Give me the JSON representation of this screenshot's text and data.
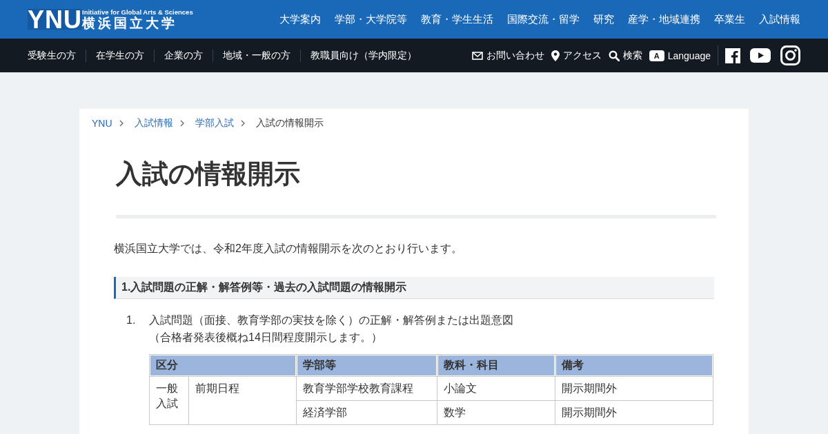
{
  "header": {
    "logo": {
      "mark": "YNU",
      "tagline": "Initiative for Global Arts & Sciences",
      "name": "横浜国立大学"
    },
    "nav": [
      "大学案内",
      "学部・大学院等",
      "教育・学生生活",
      "国際交流・留学",
      "研究",
      "産学・地域連携",
      "卒業生",
      "入試情報"
    ]
  },
  "subnav": {
    "audiences": [
      "受験生の方",
      "在学生の方",
      "企業の方",
      "地域・一般の方",
      "教職員向け（学内限定）"
    ],
    "tools": [
      {
        "kind": "mail",
        "label": "お問い合わせ"
      },
      {
        "kind": "pin",
        "label": "アクセス"
      },
      {
        "kind": "search",
        "label": "検索"
      },
      {
        "kind": "language",
        "label": "Language",
        "badge": "A"
      }
    ],
    "social": [
      {
        "kind": "facebook"
      },
      {
        "kind": "youtube"
      },
      {
        "kind": "instagram"
      }
    ]
  },
  "breadcrumb": [
    {
      "label": "YNU",
      "link": true
    },
    {
      "label": "入試情報",
      "link": true
    },
    {
      "label": "学部入試",
      "link": true
    },
    {
      "label": "入試の情報開示",
      "link": false
    }
  ],
  "page": {
    "title": "入試の情報開示",
    "intro": "横浜国立大学では、令和2年度入試の情報開示を次のとおり行います。",
    "section_heading": "1.入試問題の正解・解答例等・過去の入試問題の情報開示",
    "items": [
      {
        "number": "1.",
        "text": "入試問題（面接、教育学部の実技を除く）の正解・解答例または出題意図",
        "note": "（合格者発表後概ね14日間程度開示します。）"
      }
    ]
  },
  "table": {
    "columns": [
      "区分",
      "学部等",
      "教科・科目",
      "備考"
    ],
    "groups": [
      {
        "category": "一般入試",
        "schedule": "前期日程",
        "faculties": [
          {
            "name": "教育学部学校教育課程",
            "subjects": [
              {
                "subject": "小論文",
                "note": "開示期間外"
              }
            ]
          },
          {
            "name": "経済学部",
            "subjects": [
              {
                "subject": "数学",
                "note": "開示期間外"
              }
            ]
          }
        ]
      }
    ]
  }
}
